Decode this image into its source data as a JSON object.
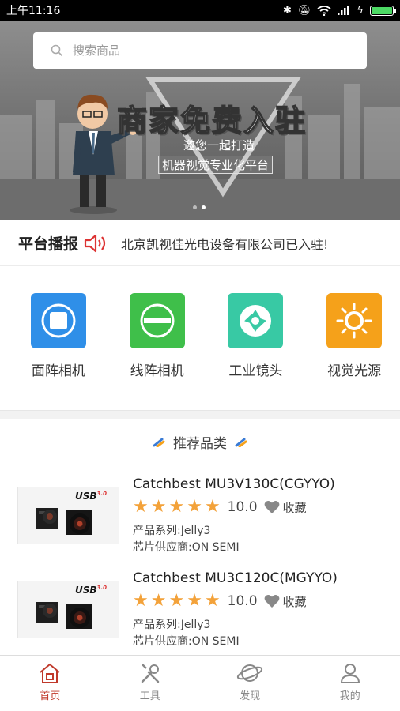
{
  "status_bar": {
    "time": "上午11:16"
  },
  "banner": {
    "search_placeholder": "搜索商品",
    "headline": "商家免费入驻",
    "sub_line1": "邀您一起打造",
    "sub_line2": "机器视觉专业化平台",
    "slide_count": 2,
    "active_slide": 2
  },
  "announcement": {
    "title": "平台播报",
    "message": "北京凯视佳光电设备有限公司已入驻!"
  },
  "categories": [
    {
      "label": "面阵相机",
      "icon": "square-camera-icon",
      "color": "#2f8fe8"
    },
    {
      "label": "线阵相机",
      "icon": "line-camera-icon",
      "color": "#3fbf4a"
    },
    {
      "label": "工业镜头",
      "icon": "aperture-icon",
      "color": "#38c9a4"
    },
    {
      "label": "视觉光源",
      "icon": "sun-icon",
      "color": "#f5a11a"
    }
  ],
  "recommend": {
    "title": "推荐品类"
  },
  "products": [
    {
      "name": "Catchbest MU3V130C(CGYYO)",
      "usb_badge": "USB",
      "usb_version": "3.0",
      "stars": 5,
      "score": "10.0",
      "fav_label": "收藏",
      "series": "产品系列:Jelly3",
      "supplier": "芯片供应商:ON SEMI"
    },
    {
      "name": "Catchbest MU3C120C(MGYYO)",
      "usb_badge": "USB",
      "usb_version": "3.0",
      "stars": 5,
      "score": "10.0",
      "fav_label": "收藏",
      "series": "产品系列:Jelly3",
      "supplier": "芯片供应商:ON SEMI"
    }
  ],
  "bottom_nav": [
    {
      "label": "首页",
      "icon": "home-icon",
      "active": true
    },
    {
      "label": "工具",
      "icon": "tools-icon",
      "active": false
    },
    {
      "label": "发现",
      "icon": "planet-icon",
      "active": false
    },
    {
      "label": "我的",
      "icon": "user-icon",
      "active": false
    }
  ],
  "colors": {
    "accent": "#c0392b",
    "star": "#f3a23a"
  }
}
